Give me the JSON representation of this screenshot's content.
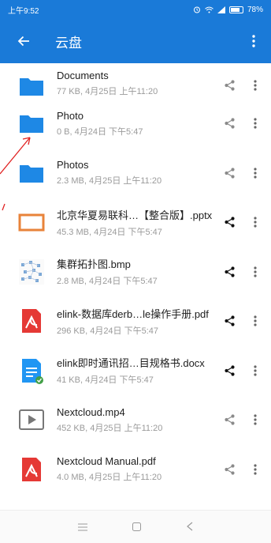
{
  "status": {
    "time": "上午9:52",
    "battery": "78%",
    "battery_level": 0.78
  },
  "appbar": {
    "title": "云盘"
  },
  "files": [
    {
      "name": "Documents",
      "meta": "77 KB, 4月25日 上午11:20",
      "type": "folder",
      "shared": false
    },
    {
      "name": "Photo",
      "meta": "0 B, 4月24日 下午5:47",
      "type": "folder",
      "shared": false
    },
    {
      "name": "Photos",
      "meta": "2.3 MB, 4月25日 上午11:20",
      "type": "folder",
      "shared": false
    },
    {
      "name": "北京华夏易联科…【整合版】.pptx",
      "meta": "45.3 MB, 4月24日 下午5:47",
      "type": "pptx",
      "shared": true
    },
    {
      "name": "集群拓扑图.bmp",
      "meta": "2.8 MB, 4月24日 下午5:47",
      "type": "image",
      "shared": true
    },
    {
      "name": "elink-数据库derb…le操作手册.pdf",
      "meta": "296 KB, 4月24日 下午5:47",
      "type": "pdf",
      "shared": true
    },
    {
      "name": "elink即时通讯招…目规格书.docx",
      "meta": "41 KB, 4月24日 下午5:47",
      "type": "docx",
      "shared": true
    },
    {
      "name": "Nextcloud.mp4",
      "meta": "452 KB, 4月25日 上午11:20",
      "type": "video",
      "shared": false
    },
    {
      "name": "Nextcloud Manual.pdf",
      "meta": "4.0 MB, 4月25日 上午11:20",
      "type": "pdf",
      "shared": false
    }
  ],
  "colors": {
    "primary": "#1a7ad8",
    "folder": "#1e88e5",
    "pdf": "#e53935",
    "pptx": "#e8833a",
    "docx": "#2196f3",
    "annotation": "#e02020"
  }
}
